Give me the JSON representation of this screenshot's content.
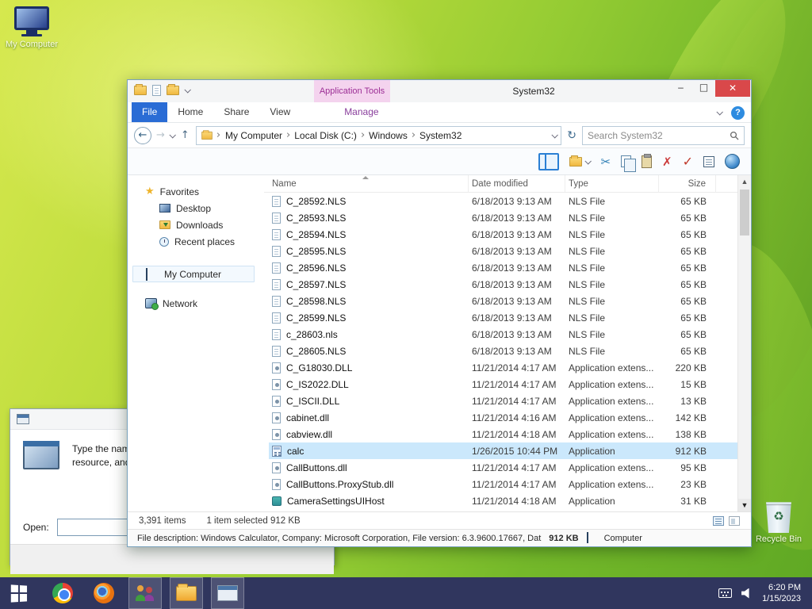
{
  "desktop": {
    "my_computer_label": "My Computer",
    "recycle_bin_label": "Recycle Bin"
  },
  "explorer": {
    "window_title": "System32",
    "contextual_tab": "Application Tools",
    "caption_buttons": {
      "minimize": "–",
      "maximize": "□",
      "close": "✕"
    },
    "help_label": "?",
    "ribbon_tabs": [
      {
        "label": "File",
        "style": "file"
      },
      {
        "label": "Home",
        "style": "normal"
      },
      {
        "label": "Share",
        "style": "normal"
      },
      {
        "label": "View",
        "style": "normal"
      },
      {
        "label": "Manage",
        "style": "manage"
      }
    ],
    "breadcrumb": [
      "My Computer",
      "Local Disk (C:)",
      "Windows",
      "System32"
    ],
    "search_placeholder": "Search System32",
    "columns": {
      "name": "Name",
      "date": "Date modified",
      "type": "Type",
      "size": "Size"
    },
    "sidebar": {
      "favorites_label": "Favorites",
      "favorites": [
        {
          "label": "Desktop",
          "icon": "desktop-icon"
        },
        {
          "label": "Downloads",
          "icon": "downloads-icon"
        },
        {
          "label": "Recent places",
          "icon": "recent-places-icon"
        }
      ],
      "computer_label": "My Computer",
      "network_label": "Network"
    },
    "files": [
      {
        "name": "C_28592.NLS",
        "date": "6/18/2013 9:13 AM",
        "type": "NLS File",
        "size": "65 KB",
        "icon": "nls",
        "selected": false
      },
      {
        "name": "C_28593.NLS",
        "date": "6/18/2013 9:13 AM",
        "type": "NLS File",
        "size": "65 KB",
        "icon": "nls",
        "selected": false
      },
      {
        "name": "C_28594.NLS",
        "date": "6/18/2013 9:13 AM",
        "type": "NLS File",
        "size": "65 KB",
        "icon": "nls",
        "selected": false
      },
      {
        "name": "C_28595.NLS",
        "date": "6/18/2013 9:13 AM",
        "type": "NLS File",
        "size": "65 KB",
        "icon": "nls",
        "selected": false
      },
      {
        "name": "C_28596.NLS",
        "date": "6/18/2013 9:13 AM",
        "type": "NLS File",
        "size": "65 KB",
        "icon": "nls",
        "selected": false
      },
      {
        "name": "C_28597.NLS",
        "date": "6/18/2013 9:13 AM",
        "type": "NLS File",
        "size": "65 KB",
        "icon": "nls",
        "selected": false
      },
      {
        "name": "C_28598.NLS",
        "date": "6/18/2013 9:13 AM",
        "type": "NLS File",
        "size": "65 KB",
        "icon": "nls",
        "selected": false
      },
      {
        "name": "C_28599.NLS",
        "date": "6/18/2013 9:13 AM",
        "type": "NLS File",
        "size": "65 KB",
        "icon": "nls",
        "selected": false
      },
      {
        "name": "c_28603.nls",
        "date": "6/18/2013 9:13 AM",
        "type": "NLS File",
        "size": "65 KB",
        "icon": "nls",
        "selected": false
      },
      {
        "name": "C_28605.NLS",
        "date": "6/18/2013 9:13 AM",
        "type": "NLS File",
        "size": "65 KB",
        "icon": "nls",
        "selected": false
      },
      {
        "name": "C_G18030.DLL",
        "date": "11/21/2014 4:17 AM",
        "type": "Application extens...",
        "size": "220 KB",
        "icon": "dll",
        "selected": false
      },
      {
        "name": "C_IS2022.DLL",
        "date": "11/21/2014 4:17 AM",
        "type": "Application extens...",
        "size": "15 KB",
        "icon": "dll",
        "selected": false
      },
      {
        "name": "C_ISCII.DLL",
        "date": "11/21/2014 4:17 AM",
        "type": "Application extens...",
        "size": "13 KB",
        "icon": "dll",
        "selected": false
      },
      {
        "name": "cabinet.dll",
        "date": "11/21/2014 4:16 AM",
        "type": "Application extens...",
        "size": "142 KB",
        "icon": "dll",
        "selected": false
      },
      {
        "name": "cabview.dll",
        "date": "11/21/2014 4:18 AM",
        "type": "Application extens...",
        "size": "138 KB",
        "icon": "dll",
        "selected": false
      },
      {
        "name": "calc",
        "date": "1/26/2015 10:44 PM",
        "type": "Application",
        "size": "912 KB",
        "icon": "calc",
        "selected": true
      },
      {
        "name": "CallButtons.dll",
        "date": "11/21/2014 4:17 AM",
        "type": "Application extens...",
        "size": "95 KB",
        "icon": "dll",
        "selected": false
      },
      {
        "name": "CallButtons.ProxyStub.dll",
        "date": "11/21/2014 4:17 AM",
        "type": "Application extens...",
        "size": "23 KB",
        "icon": "dll",
        "selected": false
      },
      {
        "name": "CameraSettingsUIHost",
        "date": "11/21/2014 4:18 AM",
        "type": "Application",
        "size": "31 KB",
        "icon": "app",
        "selected": false
      }
    ],
    "status_items": "3,391 items",
    "status_selection": "1 item selected 912 KB",
    "details_text": "File description: Windows Calculator, Company: Microsoft Corporation, File version: 6.3.9600.17667, Dat",
    "details_size": "912 KB",
    "details_right": "Computer"
  },
  "run_dialog": {
    "message": "Type the name of a program, folder, document, or Internet resource, and Windows will open it for you.",
    "open_label": "Open:",
    "input_value": ""
  },
  "taskbar": {
    "clock_time": "6:20 PM",
    "clock_date": "1/15/2023"
  }
}
